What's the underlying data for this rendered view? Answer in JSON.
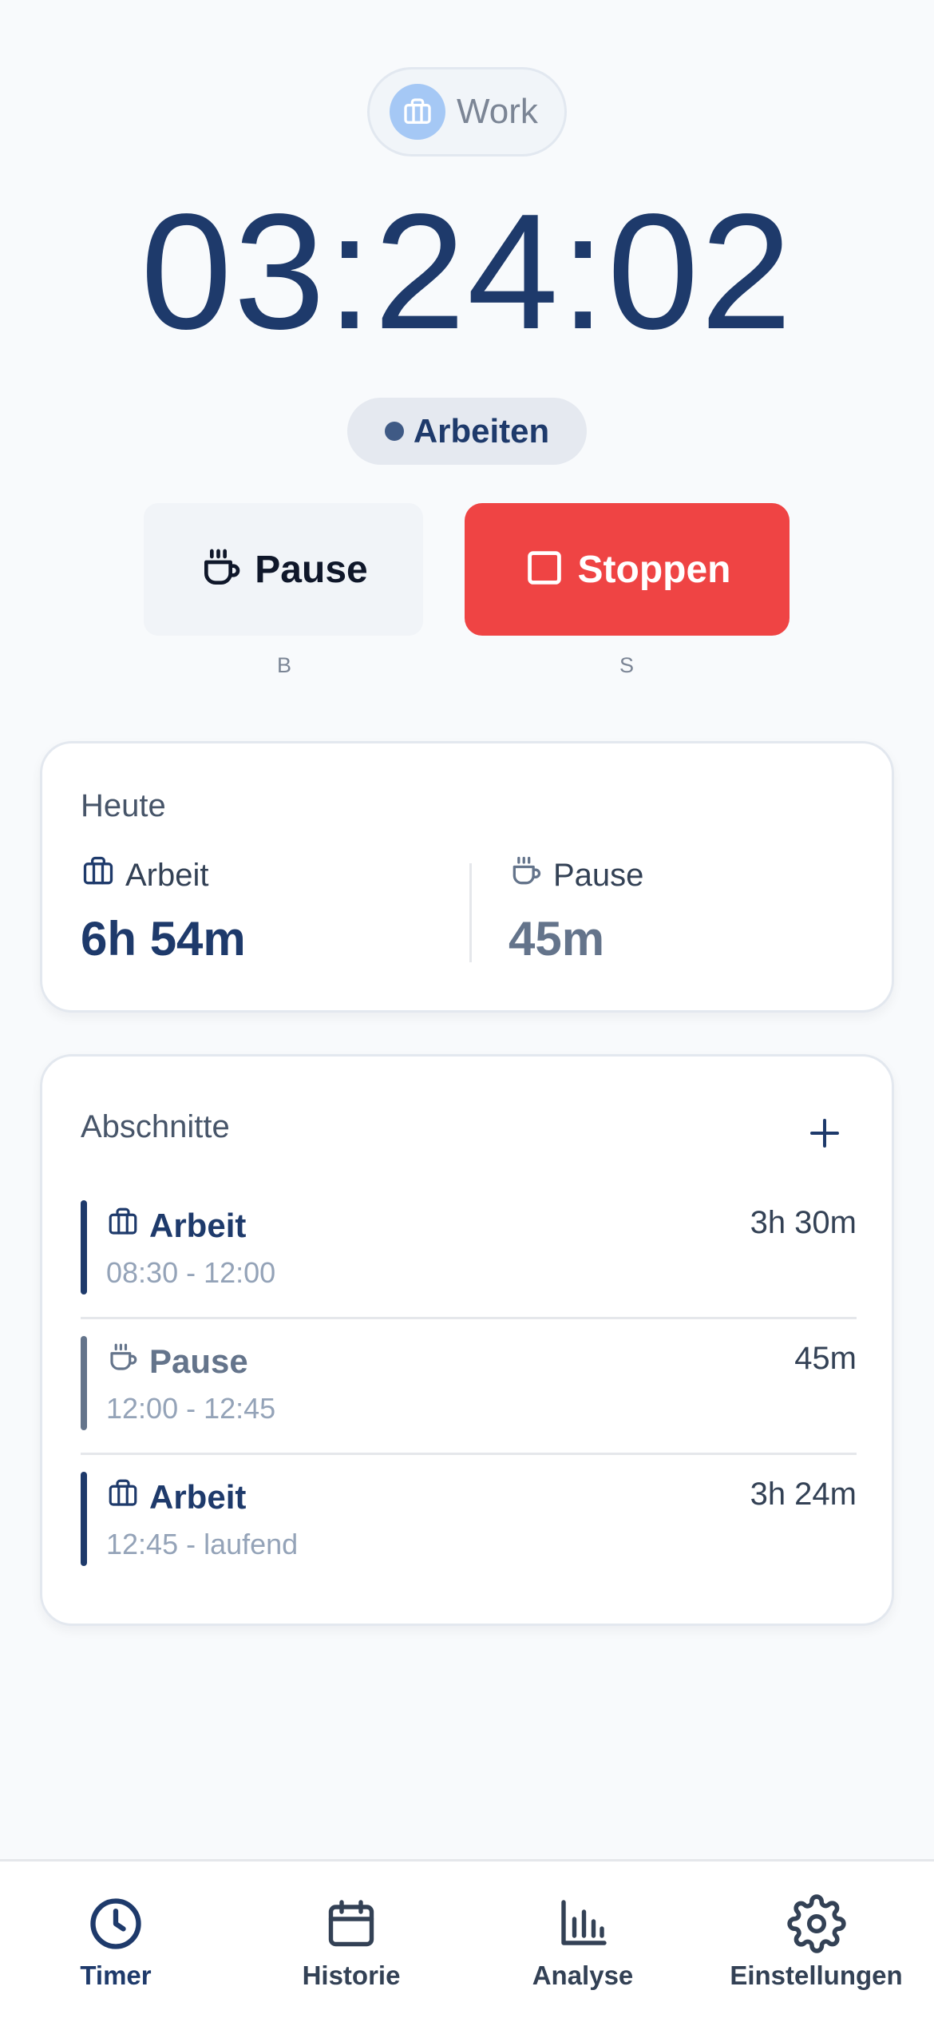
{
  "project": {
    "label": "Work",
    "icon": "briefcase-icon"
  },
  "timer": {
    "display": "03:24:02"
  },
  "status": {
    "label": "Arbeiten"
  },
  "actions": {
    "pause": {
      "label": "Pause",
      "shortcut": "B",
      "icon": "coffee-icon"
    },
    "stop": {
      "label": "Stoppen",
      "shortcut": "S",
      "icon": "stop-square-icon"
    }
  },
  "today": {
    "title": "Heute",
    "work": {
      "label": "Arbeit",
      "value": "6h 54m"
    },
    "pause": {
      "label": "Pause",
      "value": "45m"
    }
  },
  "sections": {
    "title": "Abschnitte",
    "add_icon": "plus-icon",
    "items": [
      {
        "type": "Arbeit",
        "time": "08:30 - 12:00",
        "duration": "3h 30m"
      },
      {
        "type": "Pause",
        "time": "12:00 - 12:45",
        "duration": "45m"
      },
      {
        "type": "Arbeit",
        "time": "12:45 - laufend",
        "duration": "3h 24m"
      }
    ]
  },
  "nav": {
    "items": [
      {
        "label": "Timer",
        "icon": "clock-icon",
        "active": true
      },
      {
        "label": "Historie",
        "icon": "calendar-icon",
        "active": false
      },
      {
        "label": "Analyse",
        "icon": "bar-chart-icon",
        "active": false
      },
      {
        "label": "Einstellungen",
        "icon": "gear-icon",
        "active": false
      }
    ]
  },
  "colors": {
    "primary": "#1e3a6b",
    "stop": "#ef4444",
    "pause_bar": "#64748b",
    "background": "#f8fafc"
  }
}
